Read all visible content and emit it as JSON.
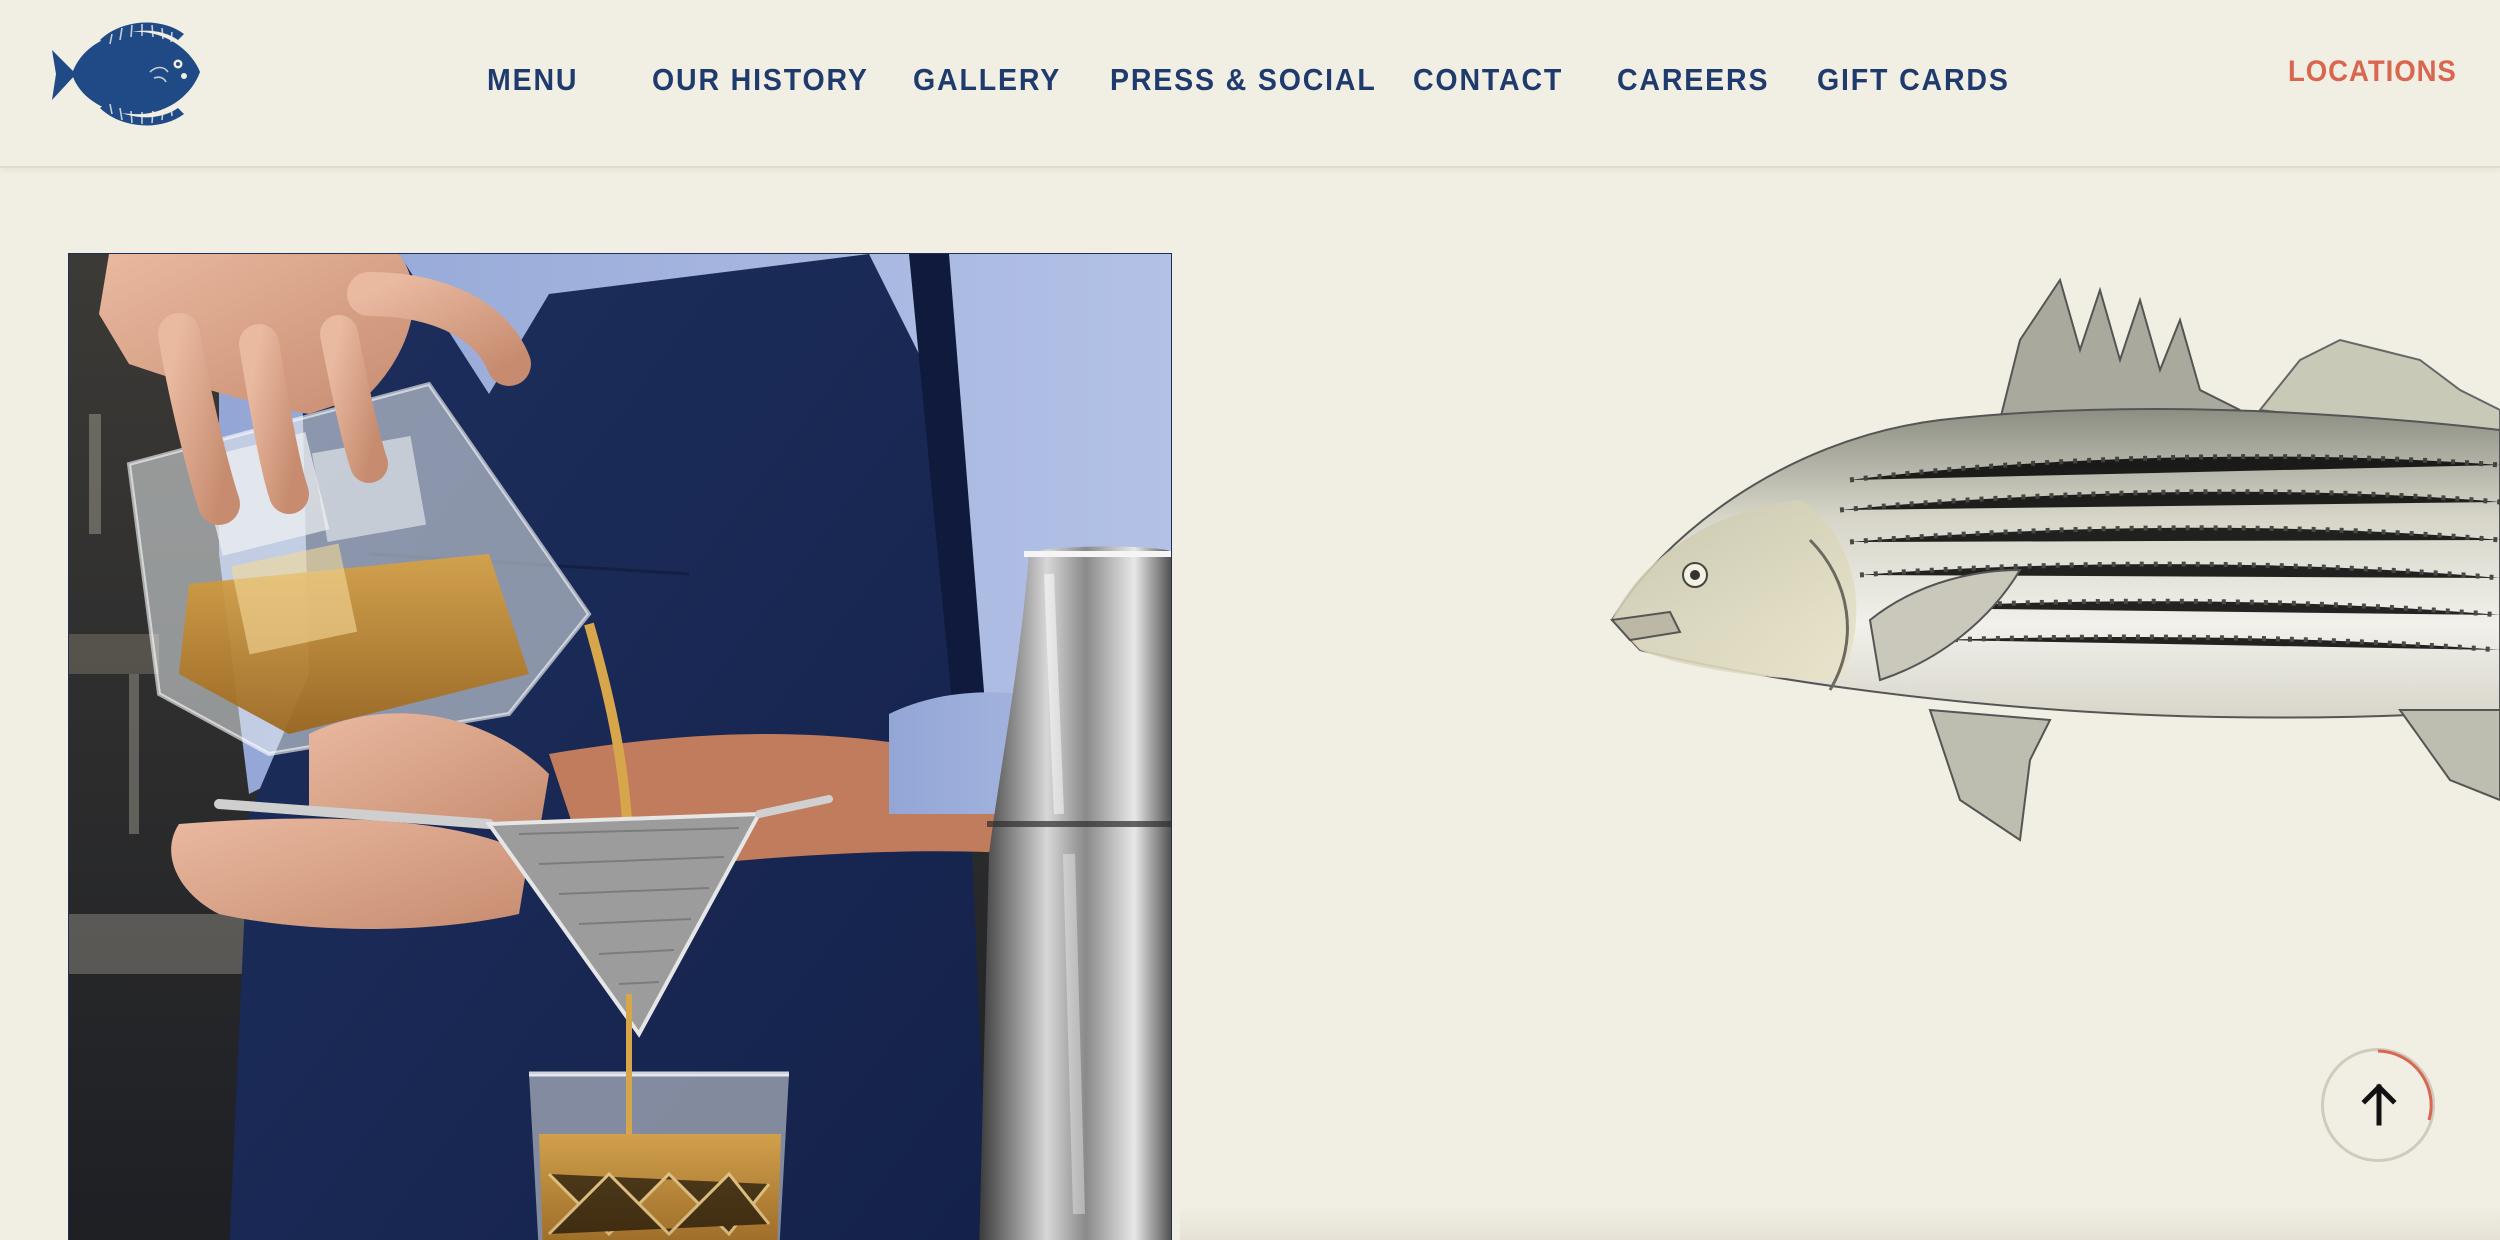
{
  "header": {
    "logo": {
      "icon": "flounder-fish-logo"
    },
    "nav": [
      {
        "label": "MENU"
      },
      {
        "label": "OUR HISTORY"
      },
      {
        "label": "GALLERY"
      },
      {
        "label": "PRESS & SOCIAL"
      },
      {
        "label": "CONTACT"
      },
      {
        "label": "CAREERS"
      },
      {
        "label": "GIFT CARDS"
      }
    ],
    "locations_label": "LOCATIONS"
  },
  "main": {
    "photo": {
      "subject": "bartender-straining-cocktail"
    },
    "illustration": {
      "subject": "striped-bass-illustration"
    }
  },
  "back_to_top": {
    "icon": "arrow-up-icon"
  },
  "colors": {
    "background": "#f1eee3",
    "nav_text": "#1f3b6e",
    "accent": "#d9674f"
  }
}
